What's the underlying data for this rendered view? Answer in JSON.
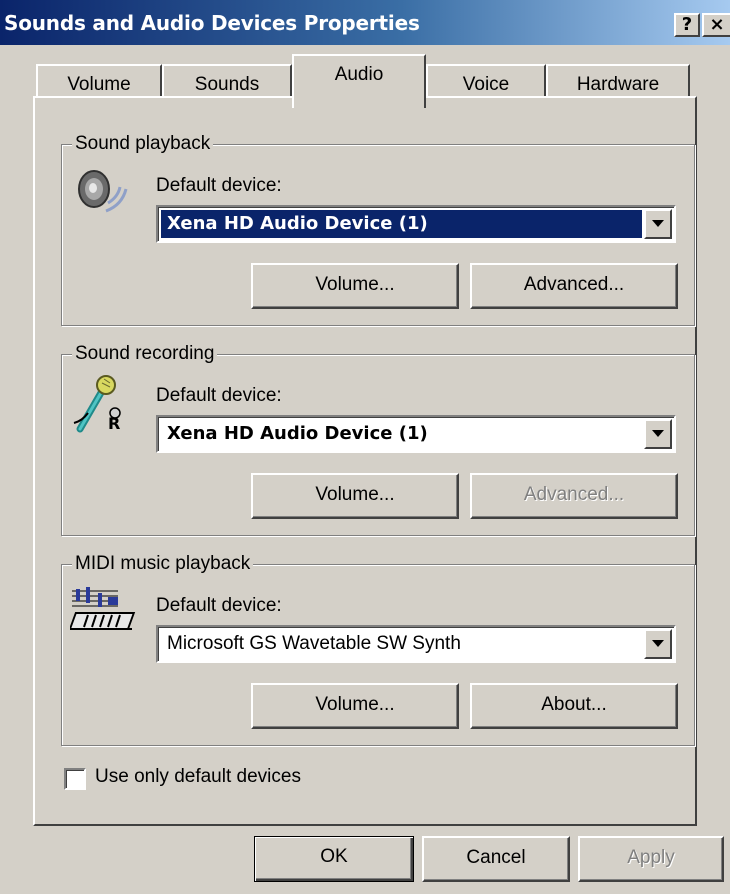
{
  "window": {
    "title": "Sounds and Audio Devices Properties",
    "help_label": "?",
    "close_label": "×"
  },
  "tabs": [
    {
      "label": "Volume",
      "active": false
    },
    {
      "label": "Sounds",
      "active": false
    },
    {
      "label": "Audio",
      "active": true
    },
    {
      "label": "Voice",
      "active": false
    },
    {
      "label": "Hardware",
      "active": false
    }
  ],
  "playback": {
    "legend": "Sound playback",
    "icon": "speaker-icon",
    "device_label": "Default device:",
    "device_value": "Xena HD Audio Device (1)",
    "volume_button": "Volume...",
    "advanced_button": "Advanced..."
  },
  "recording": {
    "legend": "Sound recording",
    "icon": "microphone-icon",
    "device_label": "Default device:",
    "device_value": "Xena HD Audio Device (1)",
    "volume_button": "Volume...",
    "advanced_button": "Advanced..."
  },
  "midi": {
    "legend": "MIDI music playback",
    "icon": "midi-keyboard-icon",
    "device_label": "Default device:",
    "device_value": "Microsoft GS Wavetable SW Synth",
    "volume_button": "Volume...",
    "about_button": "About..."
  },
  "options": {
    "use_only_default_label": "Use only default devices",
    "use_only_default_checked": false
  },
  "footer": {
    "ok_label": "OK",
    "cancel_label": "Cancel",
    "apply_label": "Apply"
  },
  "colors": {
    "face": "#d4d0c8",
    "title_start": "#0a246a",
    "title_end": "#a6caf0",
    "selection": "#0a246a"
  }
}
